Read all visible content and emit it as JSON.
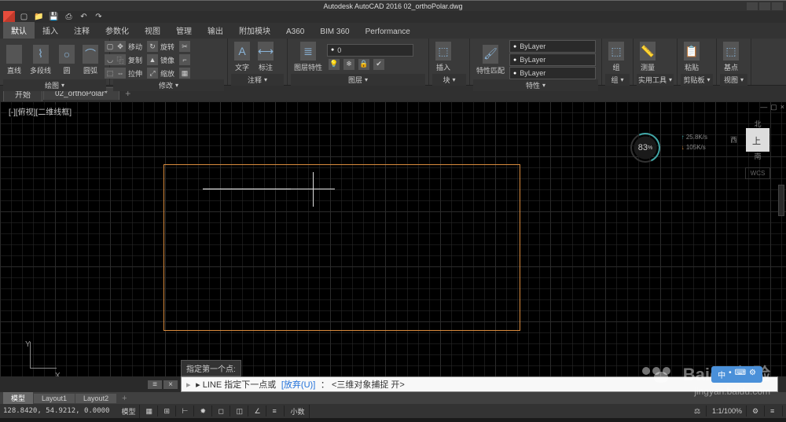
{
  "app": {
    "title": "Autodesk AutoCAD 2016   02_orthoPolar.dwg"
  },
  "ribbon_tabs": [
    "默认",
    "插入",
    "注释",
    "参数化",
    "视图",
    "管理",
    "输出",
    "附加模块",
    "A360",
    "BIM 360",
    "Performance"
  ],
  "ribbon_tabs_active": 0,
  "panels": {
    "draw": {
      "title": "绘图",
      "btns": [
        "直线",
        "多段线",
        "圆",
        "圆弧"
      ]
    },
    "modify": {
      "title": "修改",
      "rows": [
        "移动",
        "复制",
        "拉伸",
        "旋转",
        "镜像",
        "缩放",
        "修剪",
        "圆角",
        "阵列"
      ]
    },
    "annotation": {
      "title": "注释",
      "btns": [
        "文字",
        "标注"
      ]
    },
    "layers": {
      "title": "图层",
      "combo": "0",
      "btn": "图层特性"
    },
    "block": {
      "title": "块",
      "btns": [
        "插入"
      ]
    },
    "properties": {
      "title": "特性",
      "btn": "特性匹配",
      "combos": [
        "ByLayer",
        "ByLayer",
        "ByLayer"
      ]
    },
    "group": {
      "title": "组",
      "btn": "组"
    },
    "utilities": {
      "title": "实用工具",
      "btn": "测量"
    },
    "clipboard": {
      "title": "剪贴板",
      "btn": "粘贴"
    },
    "view": {
      "title": "视图",
      "btn": "基点"
    }
  },
  "file_tabs": {
    "items": [
      "开始",
      "02_orthoPolar*"
    ],
    "active": 1
  },
  "viewport_label": "[-][俯视][二维线框]",
  "gauge": {
    "percent": "83",
    "unit": "%",
    "up": "25.8K/s",
    "down": "105K/s"
  },
  "view_cube": {
    "n": "北",
    "s": "南",
    "w": "西",
    "top": "上",
    "wcs": "WCS"
  },
  "tooltip": "指定第一个点:",
  "command": {
    "prefix": "▸ LINE 指定下一点或",
    "option": "[放弃(U)]",
    "suffix": "：  <三维对象捕捉 开>"
  },
  "layout_tabs": {
    "items": [
      "模型",
      "Layout1",
      "Layout2"
    ],
    "active": 0
  },
  "status": {
    "coords": "128.8420, 54.9212, 0.0000",
    "items": [
      "模型",
      "",
      "",
      "",
      "",
      "",
      "",
      "小数",
      "",
      "",
      "",
      "1:1/100%"
    ]
  },
  "ucs": {
    "x": "X",
    "y": "Y"
  },
  "watermark": {
    "brand": "Baidu 经验",
    "url": "jingyan.baidu.com"
  },
  "ime": {
    "lang": "中",
    "items": [
      "",
      "",
      ""
    ]
  }
}
